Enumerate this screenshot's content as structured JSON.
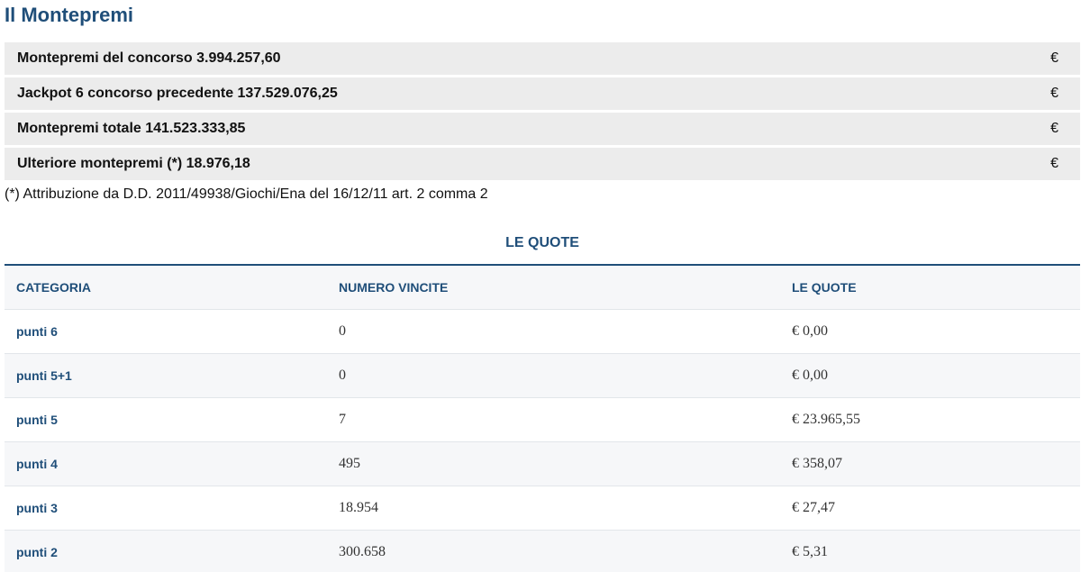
{
  "title": "Il Montepremi",
  "prizes": [
    {
      "label": "Montepremi del concorso 3.994.257,60",
      "currency": "€"
    },
    {
      "label": "Jackpot 6 concorso precedente 137.529.076,25",
      "currency": "€"
    },
    {
      "label": "Montepremi totale 141.523.333,85",
      "currency": "€"
    },
    {
      "label": "Ulteriore montepremi (*) 18.976,18",
      "currency": "€"
    }
  ],
  "footnote": "(*) Attribuzione da D.D. 2011/49938/Giochi/Ena del 16/12/11 art. 2 comma 2",
  "quote_section": {
    "title": "LE QUOTE",
    "headers": [
      "CATEGORIA",
      "NUMERO VINCITE",
      "LE QUOTE"
    ],
    "rows": [
      {
        "categoria": "punti 6",
        "vincite": "0",
        "quota": "€ 0,00"
      },
      {
        "categoria": "punti 5+1",
        "vincite": "0",
        "quota": "€ 0,00"
      },
      {
        "categoria": "punti 5",
        "vincite": "7",
        "quota": "€ 23.965,55"
      },
      {
        "categoria": "punti 4",
        "vincite": "495",
        "quota": "€ 358,07"
      },
      {
        "categoria": "punti 3",
        "vincite": "18.954",
        "quota": "€ 27,47"
      },
      {
        "categoria": "punti 2",
        "vincite": "300.658",
        "quota": "€ 5,31"
      }
    ]
  },
  "colors": {
    "accent": "#1f4e79",
    "row_bg": "#ececec",
    "alt_row_bg": "#f6f7f9"
  }
}
